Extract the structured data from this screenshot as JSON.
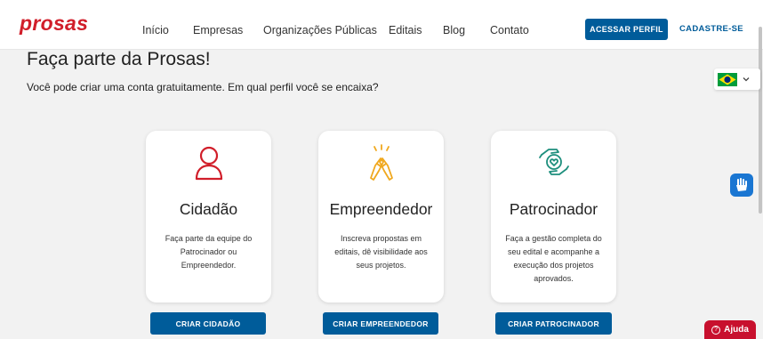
{
  "header": {
    "logo": "prosas",
    "nav": [
      "Início",
      "Empresas",
      "Organizações Públicas",
      "Editais",
      "Blog",
      "Contato"
    ],
    "profile_button": "ACESSAR PERFIL",
    "signup_link": "CADASTRE-SE"
  },
  "page": {
    "title": "Faça parte da Prosas!",
    "subtitle": "Você pode criar uma conta gratuitamente. Em qual perfil você se encaixa?"
  },
  "language": {
    "flag": "brazil-flag-icon"
  },
  "cards": [
    {
      "title": "Cidadão",
      "description": "Faça parte da equipe do Patrocinador ou Empreendedor.",
      "button": "CRIAR CIDADÃO",
      "icon": "user-icon",
      "color": "#d11e2a"
    },
    {
      "title": "Empreendedor",
      "description": "Inscreva propostas em editais, dê visibilidade aos seus projetos.",
      "button": "CRIAR EMPREENDEDOR",
      "icon": "high-five-icon",
      "color": "#f0a81e"
    },
    {
      "title": "Patrocinador",
      "description": "Faça a gestão completa do seu edital e acompanhe a execução dos projetos aprovados.",
      "button": "CRIAR PATROCINADOR",
      "icon": "heart-hands-icon",
      "color": "#1e8f7d"
    }
  ],
  "help": {
    "label": "Ajuda"
  },
  "colors": {
    "brand": "#d11e2a",
    "primary": "#005c9a"
  }
}
